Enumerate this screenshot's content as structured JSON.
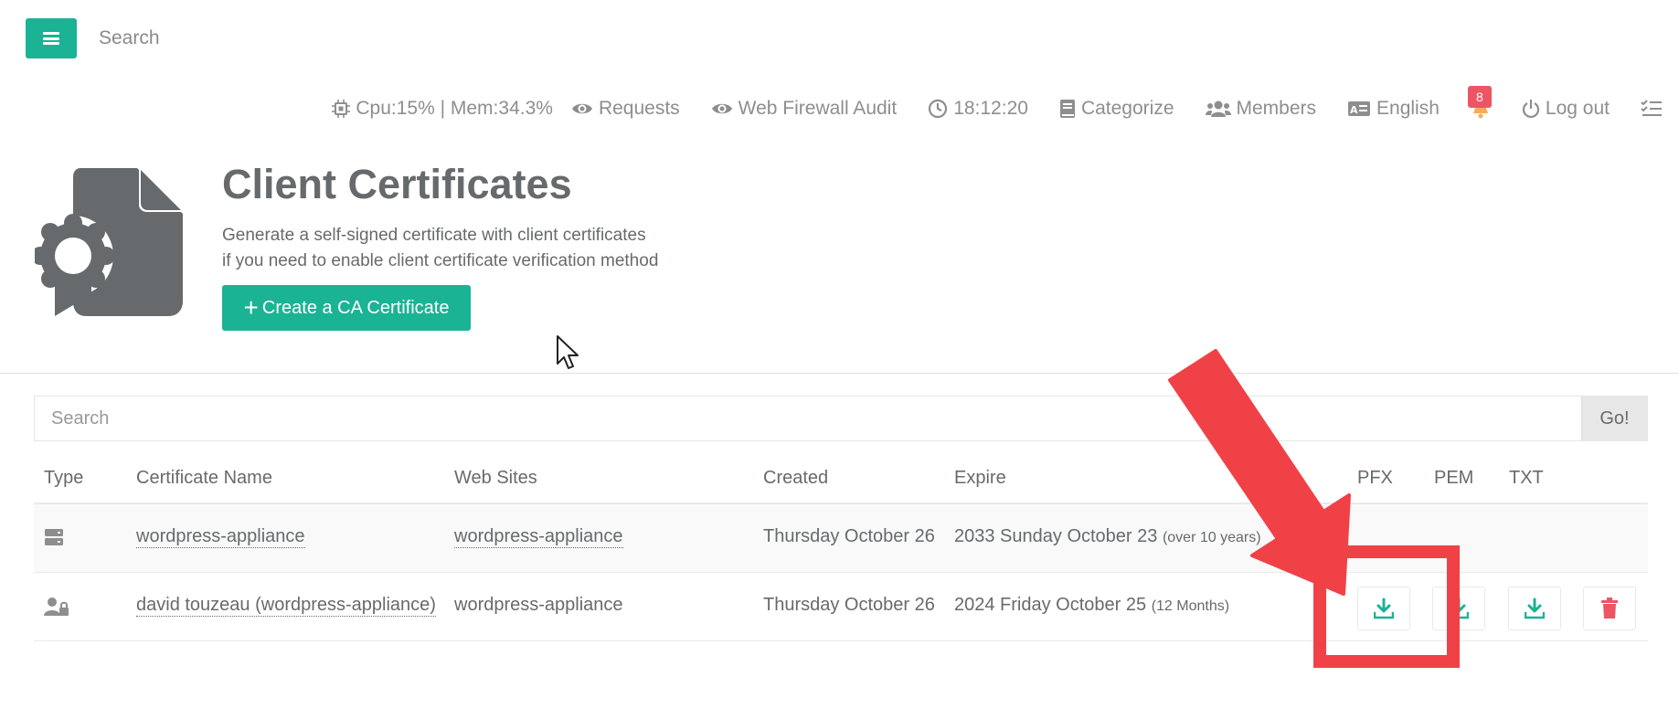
{
  "topbar": {
    "search_placeholder": "Search"
  },
  "navbar": {
    "stats": "Cpu:15% | Mem:34.3%",
    "requests": "Requests",
    "waf_audit": "Web Firewall Audit",
    "time": "18:12:20",
    "categorize": "Categorize",
    "members": "Members",
    "language": "English",
    "notification_count": "8",
    "logout": "Log out"
  },
  "header": {
    "title": "Client Certificates",
    "subtitle_line1": "Generate a self-signed certificate with client certificates",
    "subtitle_line2": "if you need to enable client certificate verification method",
    "create_button": "Create a CA Certificate"
  },
  "table_search": {
    "placeholder": "Search",
    "go_label": "Go!"
  },
  "table": {
    "columns": {
      "type": "Type",
      "name": "Certificate Name",
      "sites": "Web Sites",
      "created": "Created",
      "expire": "Expire",
      "pfx": "PFX",
      "pem": "PEM",
      "txt": "TXT"
    },
    "rows": [
      {
        "type_icon": "server-icon",
        "name": "wordpress-appliance",
        "sites": "wordpress-appliance",
        "created": "Thursday October 26",
        "expire": "2033 Sunday October 23",
        "expire_note": "(over 10 years)"
      },
      {
        "type_icon": "user-lock-icon",
        "name": "david touzeau (wordpress-appliance)",
        "sites": "wordpress-appliance",
        "created": "Thursday October 26",
        "expire": "2024 Friday October 25",
        "expire_note": "(12 Months)"
      }
    ]
  },
  "colors": {
    "primary": "#1ab394",
    "danger": "#ed5565",
    "annotation": "#f04147"
  }
}
